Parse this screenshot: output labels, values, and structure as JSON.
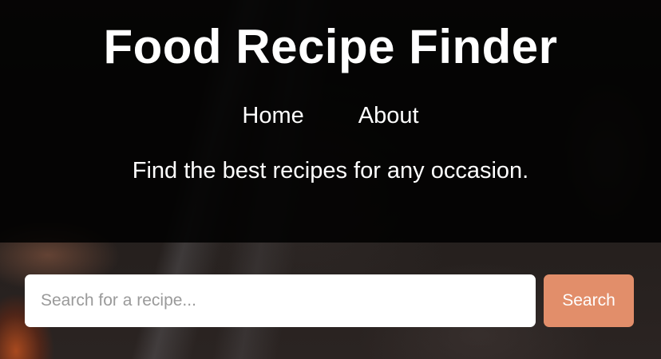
{
  "header": {
    "title": "Food Recipe Finder",
    "nav": [
      {
        "label": "Home"
      },
      {
        "label": "About"
      }
    ],
    "tagline": "Find the best recipes for any occasion."
  },
  "search": {
    "placeholder": "Search for a recipe...",
    "value": "",
    "button_label": "Search"
  },
  "colors": {
    "accent": "#e28e6a",
    "header_overlay": "#000000",
    "text": "#ffffff"
  }
}
